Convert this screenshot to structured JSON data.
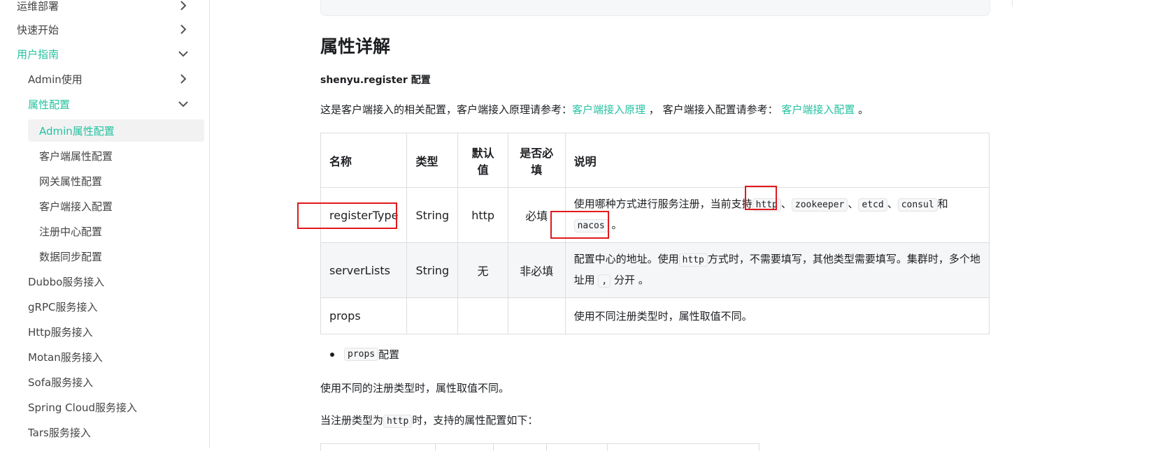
{
  "sidebar": {
    "items": [
      {
        "label": "运维部署",
        "chevron": "right"
      },
      {
        "label": "快速开始",
        "chevron": "right"
      },
      {
        "label": "用户指南",
        "chevron": "down"
      },
      {
        "label": "Admin使用",
        "chevron": "right"
      },
      {
        "label": "属性配置",
        "chevron": "down"
      },
      {
        "label": "Admin属性配置"
      },
      {
        "label": "客户端属性配置"
      },
      {
        "label": "网关属性配置"
      },
      {
        "label": "客户端接入配置"
      },
      {
        "label": "注册中心配置"
      },
      {
        "label": "数据同步配置"
      },
      {
        "label": "Dubbo服务接入"
      },
      {
        "label": "gRPC服务接入"
      },
      {
        "label": "Http服务接入"
      },
      {
        "label": "Motan服务接入"
      },
      {
        "label": "Sofa服务接入"
      },
      {
        "label": "Spring Cloud服务接入"
      },
      {
        "label": "Tars服务接入"
      }
    ]
  },
  "content": {
    "title": "属性详解",
    "subhead_code": "shenyu.register",
    "subhead_suffix": " 配置",
    "intro_prefix": "这是客户端接入的相关配置，客户端接入原理请参考：",
    "intro_link1": "客户端接入原理",
    "intro_mid": " ， 客户端接入配置请参考： ",
    "intro_link2": "客户端接入配置",
    "intro_suffix": " 。",
    "table": {
      "headers": [
        "名称",
        "类型",
        "默认值",
        "是否必填",
        "说明"
      ],
      "header_lines": {
        "default_1": "默认",
        "default_2": "值",
        "required_1": "是否必",
        "required_2": "填"
      },
      "rows": [
        {
          "name": "registerType",
          "type": "String",
          "default": "http",
          "required": "必填",
          "desc_prefix": "使用哪种方式进行服务注册，当前支持",
          "codes": [
            "http",
            "zookeeper",
            "etcd",
            "consul",
            "nacos"
          ],
          "sep": "、",
          "and": "和",
          "desc_suffix": " 。"
        },
        {
          "name": "serverLists",
          "type": "String",
          "default": "无",
          "required": "非必填",
          "desc_prefix": "配置中心的地址。使用",
          "code": "http",
          "desc_mid": "方式时，不需要填写，其他类型需要填写。集群时，多个地址用 ",
          "code2": ",",
          "desc_suffix": " 分开 。"
        },
        {
          "name": "props",
          "type": "",
          "default": "",
          "required": "",
          "desc": "使用不同注册类型时，属性取值不同。"
        }
      ]
    },
    "bullet_code": "props",
    "bullet_suffix": "配置",
    "para1": "使用不同的注册类型时，属性取值不同。",
    "para2_prefix": "当注册类型为",
    "para2_code": "http",
    "para2_suffix": "时，支持的属性配置如下："
  },
  "colors": {
    "accent": "#25c2a0",
    "highlight": "#e0191d"
  }
}
